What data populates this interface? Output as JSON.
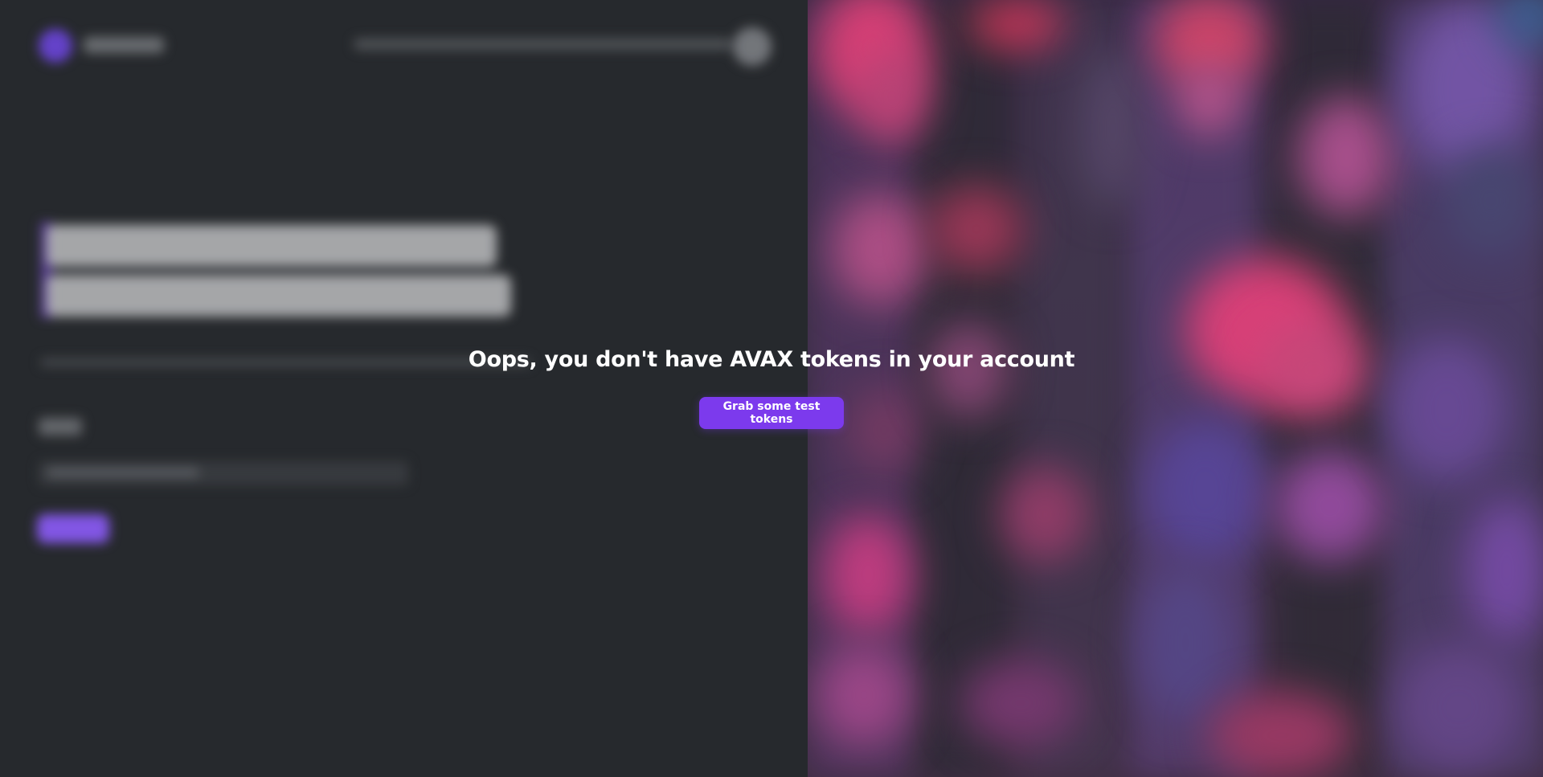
{
  "modal": {
    "message": "Oops, you don't have AVAX tokens in your account",
    "button_label": "Grab some test tokens"
  },
  "colors": {
    "background": "#282b2f",
    "accent": "#7c3aed",
    "text": "#ffffff"
  }
}
